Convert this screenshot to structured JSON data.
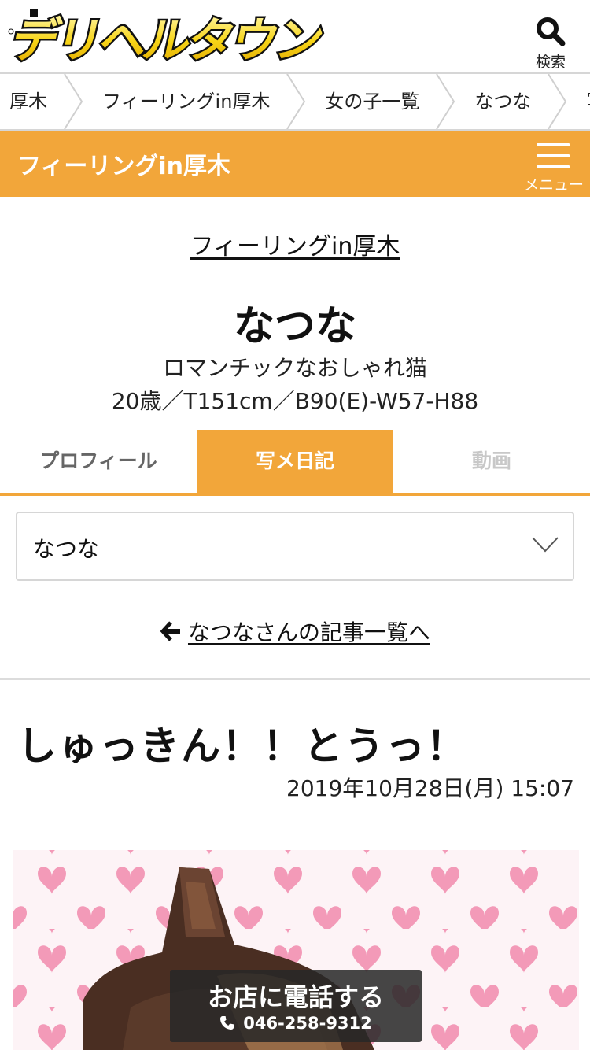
{
  "header": {
    "logo_text": "デリヘルタウン",
    "search_label": "検索"
  },
  "breadcrumb": {
    "items": [
      "厚木",
      "フィーリングin厚木",
      "女の子一覧",
      "なつな",
      "写メ日記"
    ]
  },
  "shop_bar": {
    "title": "フィーリングin厚木",
    "menu_label": "メニュー"
  },
  "profile": {
    "shop_link": "フィーリングin厚木",
    "name": "なつな",
    "catchphrase": "ロマンチックなおしゃれ猫",
    "specs": "20歳／T151cm／B90(E)-W57-H88"
  },
  "tabs": {
    "profile": "プロフィール",
    "diary": "写メ日記",
    "video": "動画"
  },
  "filter": {
    "selected": "なつな"
  },
  "back_link": "なつなさんの記事一覧へ",
  "post": {
    "title": "しゅっきん！！とうっ！",
    "date": "2019年10月28日(月) 15:07"
  },
  "call_button": {
    "label": "お店に電話する",
    "phone": "046-258-9312"
  },
  "colors": {
    "accent": "#f2a63a",
    "logo_yellow": "#f7d417",
    "heart_pink": "#f39ab8"
  },
  "icons": {
    "search": "search-icon",
    "menu": "hamburger-icon",
    "chevron": "chevron-down-icon",
    "back": "arrow-left-icon",
    "phone": "phone-icon"
  }
}
